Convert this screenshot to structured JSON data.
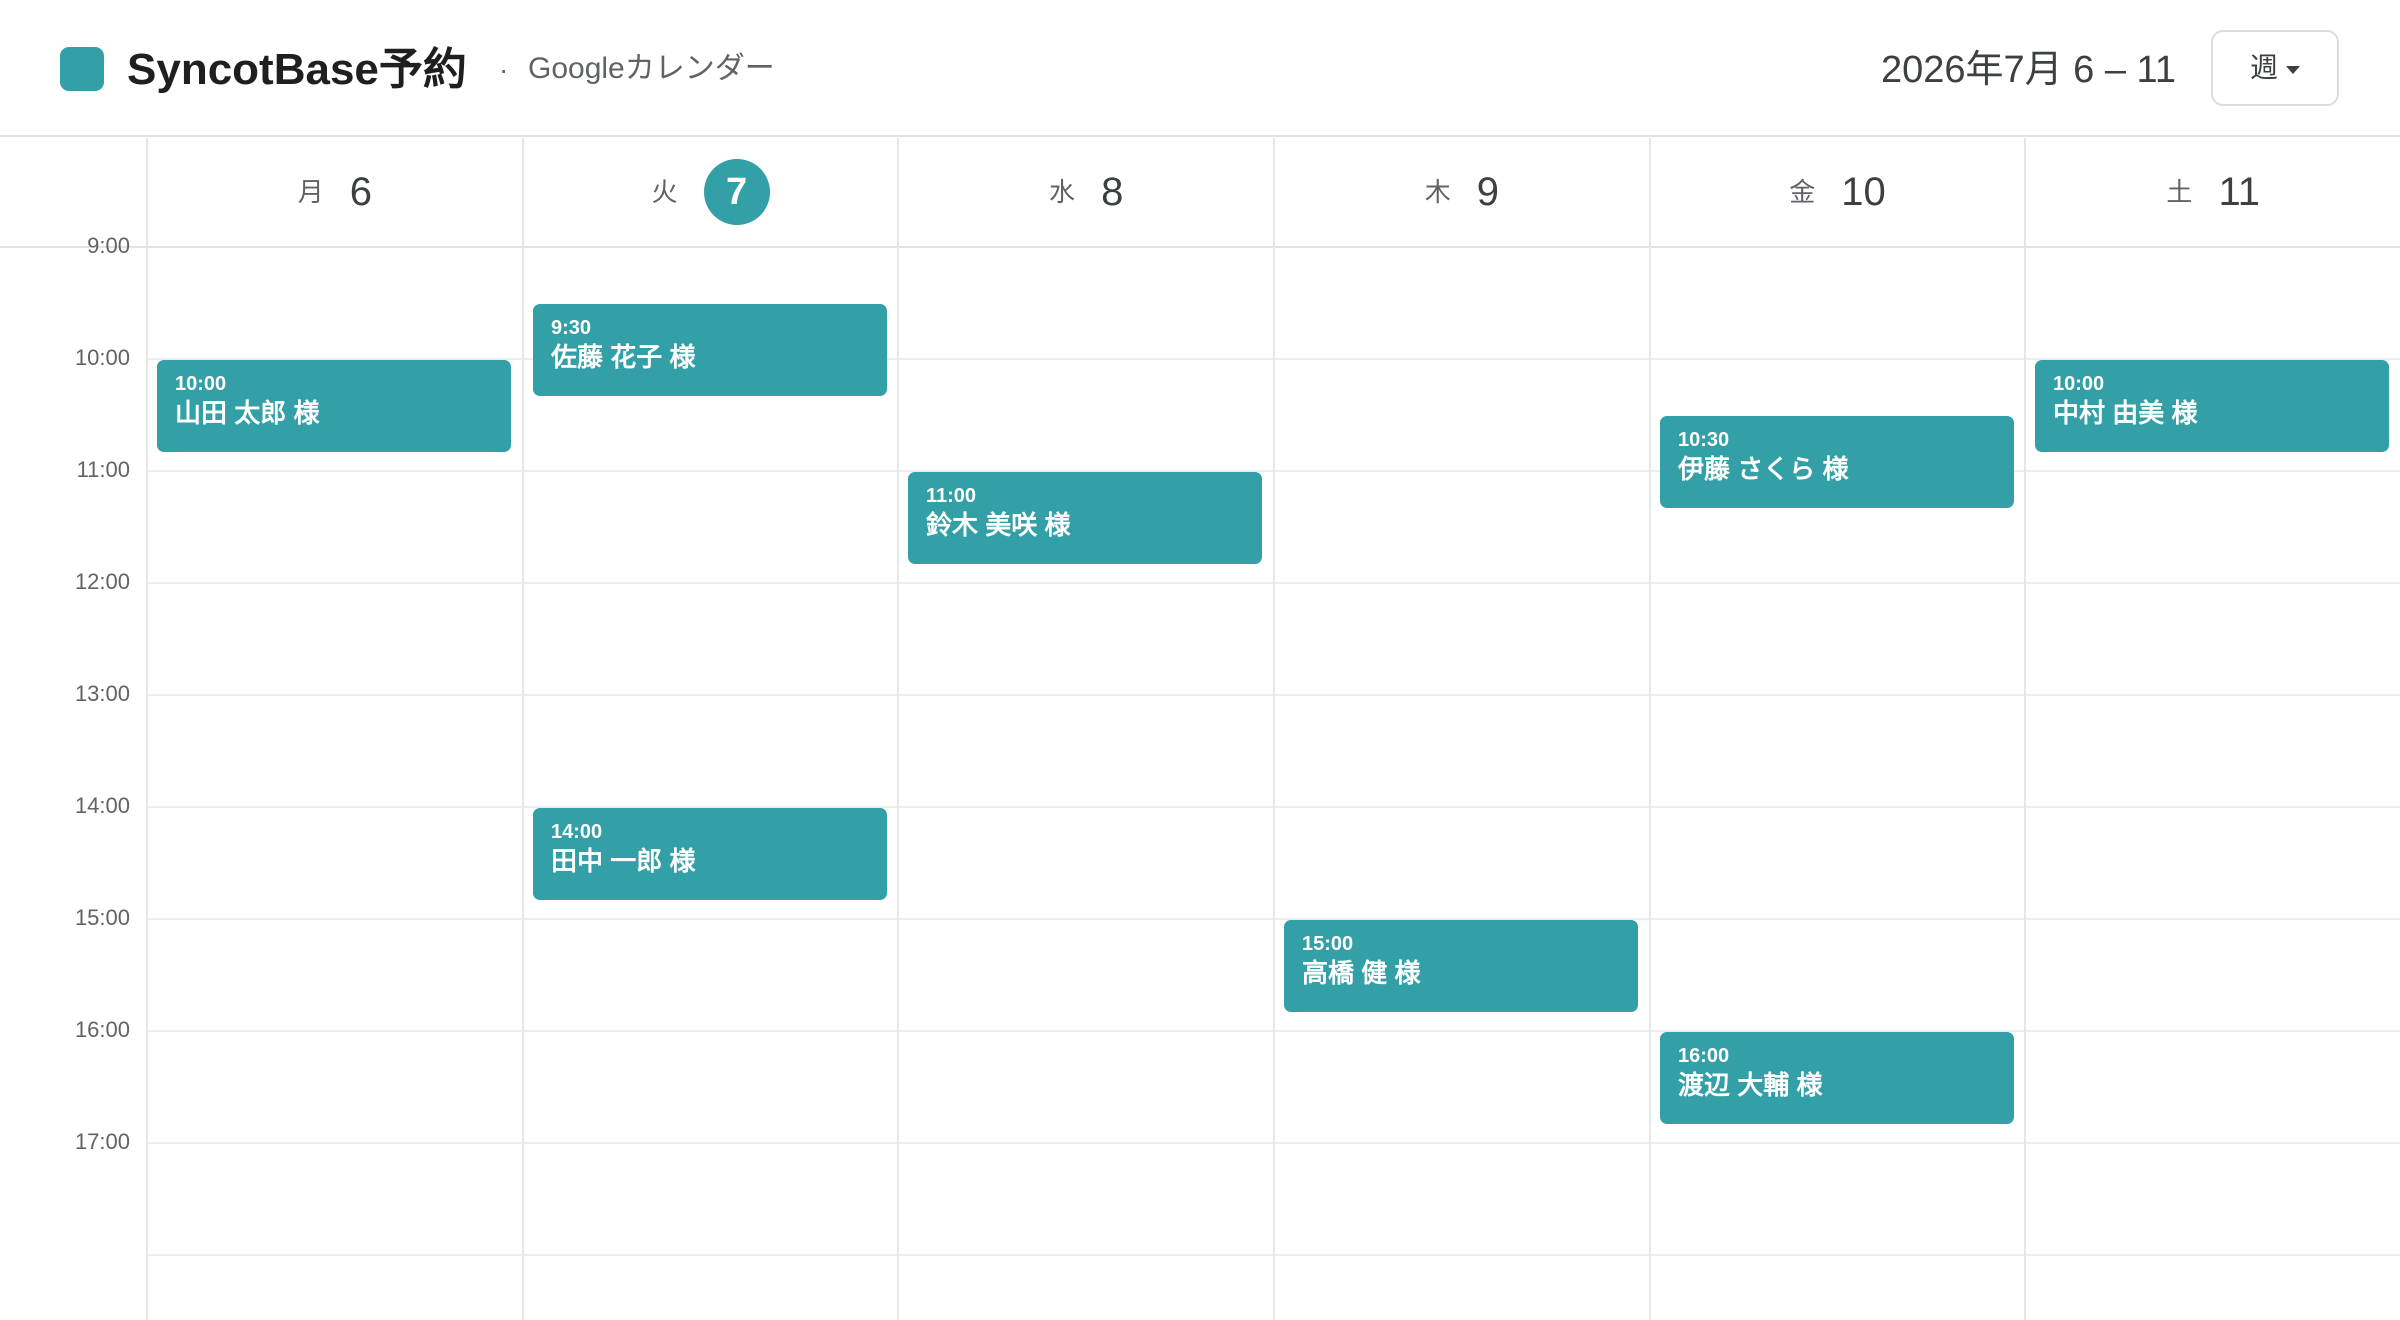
{
  "header": {
    "app_title": "SyncotBase予約",
    "separator": "·",
    "subtitle": "Googleカレンダー",
    "date_range": "2026年7月 6 – 11",
    "view_label": "週"
  },
  "days": [
    {
      "dow": "月",
      "num": "6"
    },
    {
      "dow": "火",
      "num": "7",
      "today": true
    },
    {
      "dow": "水",
      "num": "8"
    },
    {
      "dow": "木",
      "num": "9"
    },
    {
      "dow": "金",
      "num": "10"
    },
    {
      "dow": "土",
      "num": "11"
    }
  ],
  "time_labels": [
    "9:00",
    "10:00",
    "11:00",
    "12:00",
    "13:00",
    "14:00",
    "15:00",
    "16:00",
    "17:00"
  ],
  "events": [
    {
      "day": 0,
      "start": "10:00",
      "name": "山田 太郎 様"
    },
    {
      "day": 1,
      "start": "9:30",
      "name": "佐藤 花子 様"
    },
    {
      "day": 1,
      "start": "14:00",
      "name": "田中 一郎 様"
    },
    {
      "day": 2,
      "start": "11:00",
      "name": "鈴木 美咲 様"
    },
    {
      "day": 3,
      "start": "15:00",
      "name": "高橋 健 様"
    },
    {
      "day": 4,
      "start": "10:30",
      "name": "伊藤 さくら 様"
    },
    {
      "day": 4,
      "start": "16:00",
      "name": "渡辺 大輔 様"
    },
    {
      "day": 5,
      "start": "10:00",
      "name": "中村 由美 様"
    }
  ],
  "colors": {
    "accent": "#339fa6",
    "grid": "#ececec"
  },
  "icons": {
    "view_dropdown": "caret-down-icon",
    "brand": "brand-square-icon"
  }
}
